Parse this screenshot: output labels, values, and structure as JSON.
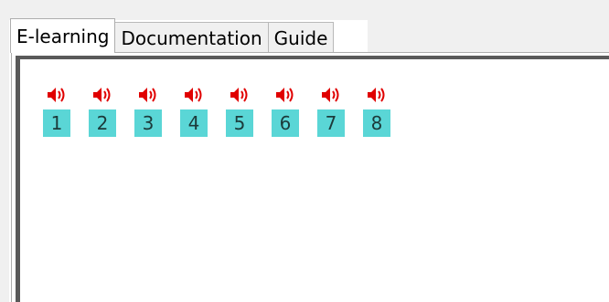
{
  "tabs": [
    {
      "label": "E-learning",
      "active": true
    },
    {
      "label": "Documentation",
      "active": false
    },
    {
      "label": "Guide",
      "active": false
    }
  ],
  "items": [
    {
      "number": "1",
      "icon": "speaker-icon"
    },
    {
      "number": "2",
      "icon": "speaker-icon"
    },
    {
      "number": "3",
      "icon": "speaker-icon"
    },
    {
      "number": "4",
      "icon": "speaker-icon"
    },
    {
      "number": "5",
      "icon": "speaker-icon"
    },
    {
      "number": "6",
      "icon": "speaker-icon"
    },
    {
      "number": "7",
      "icon": "speaker-icon"
    },
    {
      "number": "8",
      "icon": "speaker-icon"
    }
  ],
  "colors": {
    "speaker": "#e00000",
    "number_bg": "#5ad6d6",
    "number_text": "#1c3a3a"
  }
}
